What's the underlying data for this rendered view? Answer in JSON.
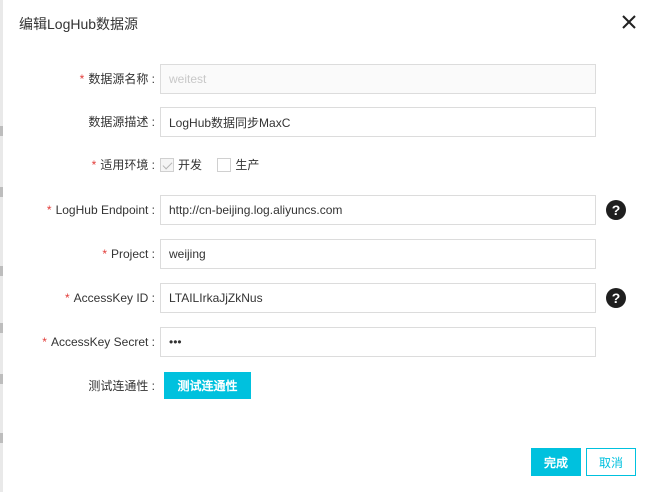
{
  "dialog": {
    "title": "编辑LogHub数据源",
    "close_icon": "close-icon"
  },
  "form": {
    "required_mark": "*",
    "datasource_name": {
      "label": "数据源名称 :",
      "value": "weitest",
      "required": true,
      "disabled": true
    },
    "datasource_desc": {
      "label": "数据源描述 :",
      "value": "LogHub数据同步MaxC",
      "required": false
    },
    "environment": {
      "label": "适用环境 :",
      "required": true,
      "options": [
        {
          "label": "开发",
          "checked": true
        },
        {
          "label": "生产",
          "checked": false
        }
      ]
    },
    "endpoint": {
      "label": "LogHub Endpoint :",
      "value": "http://cn-beijing.log.aliyuncs.com",
      "required": true,
      "help": "?"
    },
    "project": {
      "label": "Project :",
      "value": "weijing",
      "required": true
    },
    "access_key_id": {
      "label": "AccessKey ID :",
      "value": "LTAILIrkaJjZkNus",
      "required": true,
      "help": "?"
    },
    "access_key_secret": {
      "label": "AccessKey Secret :",
      "value": "•••",
      "required": true
    },
    "test_connection": {
      "label": "测试连通性 :",
      "button": "测试连通性"
    }
  },
  "footer": {
    "ok": "完成",
    "cancel": "取消"
  },
  "colors": {
    "accent": "#00c1de",
    "required": "#e23c39"
  }
}
